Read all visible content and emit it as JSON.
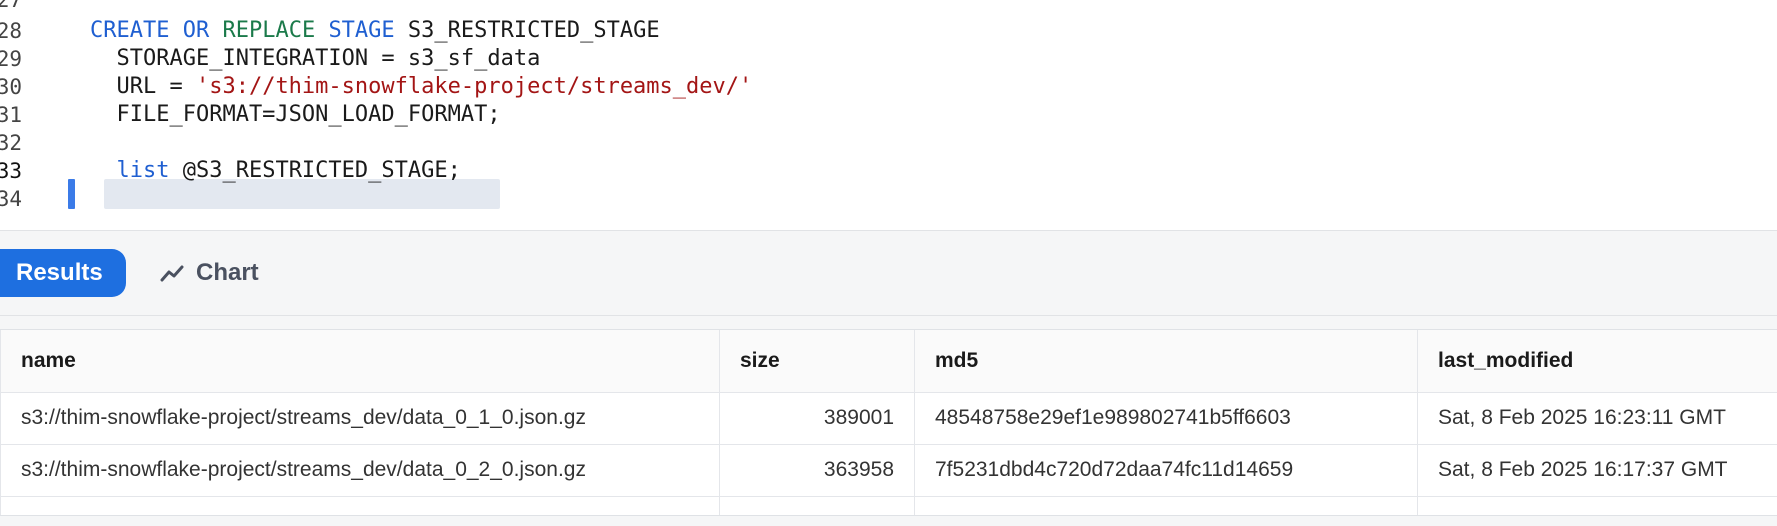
{
  "editor": {
    "lines": [
      {
        "num": "27",
        "text": ""
      },
      {
        "num": "28",
        "tokens": [
          {
            "t": "CREATE ",
            "c": "kw"
          },
          {
            "t": "OR ",
            "c": "kw"
          },
          {
            "t": "REPLACE ",
            "c": "kw-green"
          },
          {
            "t": "STAGE ",
            "c": "kw"
          },
          {
            "t": "S3_RESTRICTED_STAGE",
            "c": ""
          }
        ]
      },
      {
        "num": "29",
        "tokens": [
          {
            "t": "  STORAGE_INTEGRATION = s3_sf_data",
            "c": ""
          }
        ]
      },
      {
        "num": "30",
        "tokens": [
          {
            "t": "  URL = ",
            "c": ""
          },
          {
            "t": "'s3://thim-snowflake-project/streams_dev/'",
            "c": "str"
          }
        ]
      },
      {
        "num": "31",
        "tokens": [
          {
            "t": "  FILE_FORMAT=JSON_LOAD_FORMAT;",
            "c": ""
          }
        ]
      },
      {
        "num": "32",
        "tokens": []
      },
      {
        "num": "33",
        "tokens": [
          {
            "t": "  list",
            "c": "kw"
          },
          {
            "t": " @S3_RESTRICTED_STAGE;",
            "c": ""
          }
        ]
      },
      {
        "num": "34",
        "tokens": []
      }
    ]
  },
  "tabs": {
    "results_label": "Results",
    "chart_label": "Chart",
    "chart_icon": "line-chart-icon",
    "accent": "#1e6fe0"
  },
  "table": {
    "columns": [
      "name",
      "size",
      "md5",
      "last_modified"
    ],
    "rows": [
      [
        "s3://thim-snowflake-project/streams_dev/data_0_1_0.json.gz",
        "389001",
        "48548758e29ef1e989802741b5ff6603",
        "Sat, 8 Feb 2025 16:23:11 GMT"
      ],
      [
        "s3://thim-snowflake-project/streams_dev/data_0_2_0.json.gz",
        "363958",
        "7f5231dbd4c720d72daa74fc11d14659",
        "Sat, 8 Feb 2025 16:17:37 GMT"
      ]
    ]
  }
}
